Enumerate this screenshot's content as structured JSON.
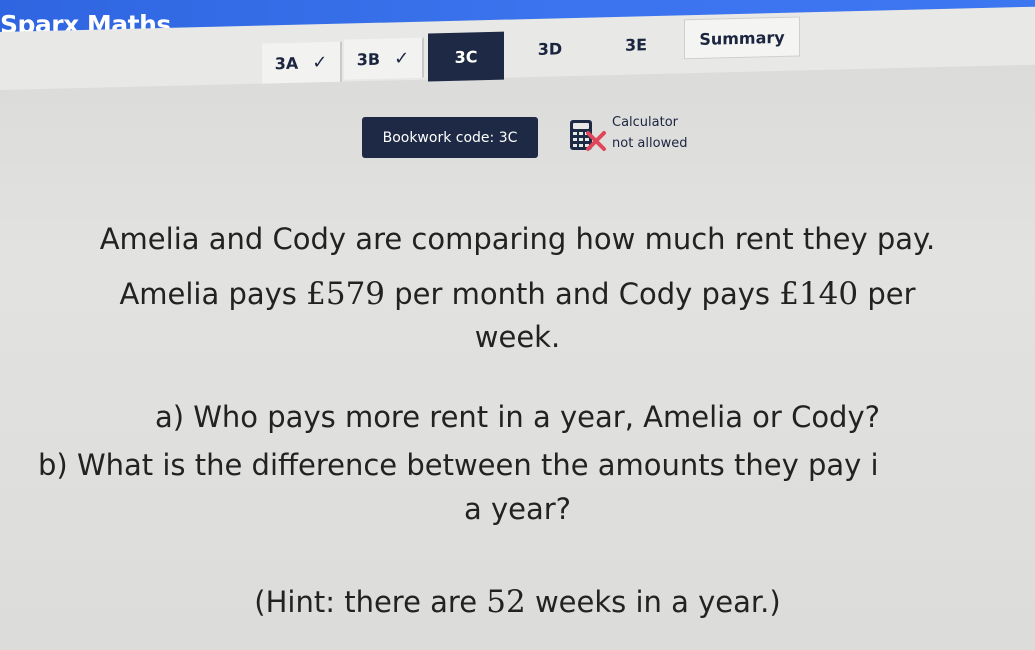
{
  "app": {
    "title": "Sparx Maths"
  },
  "tabs": [
    {
      "label": "3A",
      "state": "done"
    },
    {
      "label": "3B",
      "state": "done"
    },
    {
      "label": "3C",
      "state": "active"
    },
    {
      "label": "3D",
      "state": "pending"
    },
    {
      "label": "3E",
      "state": "pending"
    },
    {
      "label": "Summary",
      "state": "summary"
    }
  ],
  "check_glyph": "✓",
  "bookwork": {
    "label": "Bookwork code: 3C"
  },
  "calculator": {
    "line1": "Calculator",
    "line2": "not allowed",
    "icon": "calculator-crossed-icon"
  },
  "question": {
    "line1": "Amelia and Cody are comparing how much rent they pay.",
    "line2_pre": "Amelia pays ",
    "amount1": "£579",
    "line2_mid": " per month and Cody pays ",
    "amount2": "£140",
    "line2_post": " per",
    "line3": "week.",
    "part_a": "a) Who pays more rent in a year, Amelia or Cody?",
    "part_b1": "b) What is the difference between the amounts they pay i",
    "part_b2": "a year?",
    "hint_pre": "(Hint: there are ",
    "hint_num": "52",
    "hint_post": " weeks in a year.)"
  },
  "colors": {
    "brand_blue": "#3b74ee",
    "navy": "#1e2a45",
    "cross_red": "#e0455a"
  }
}
